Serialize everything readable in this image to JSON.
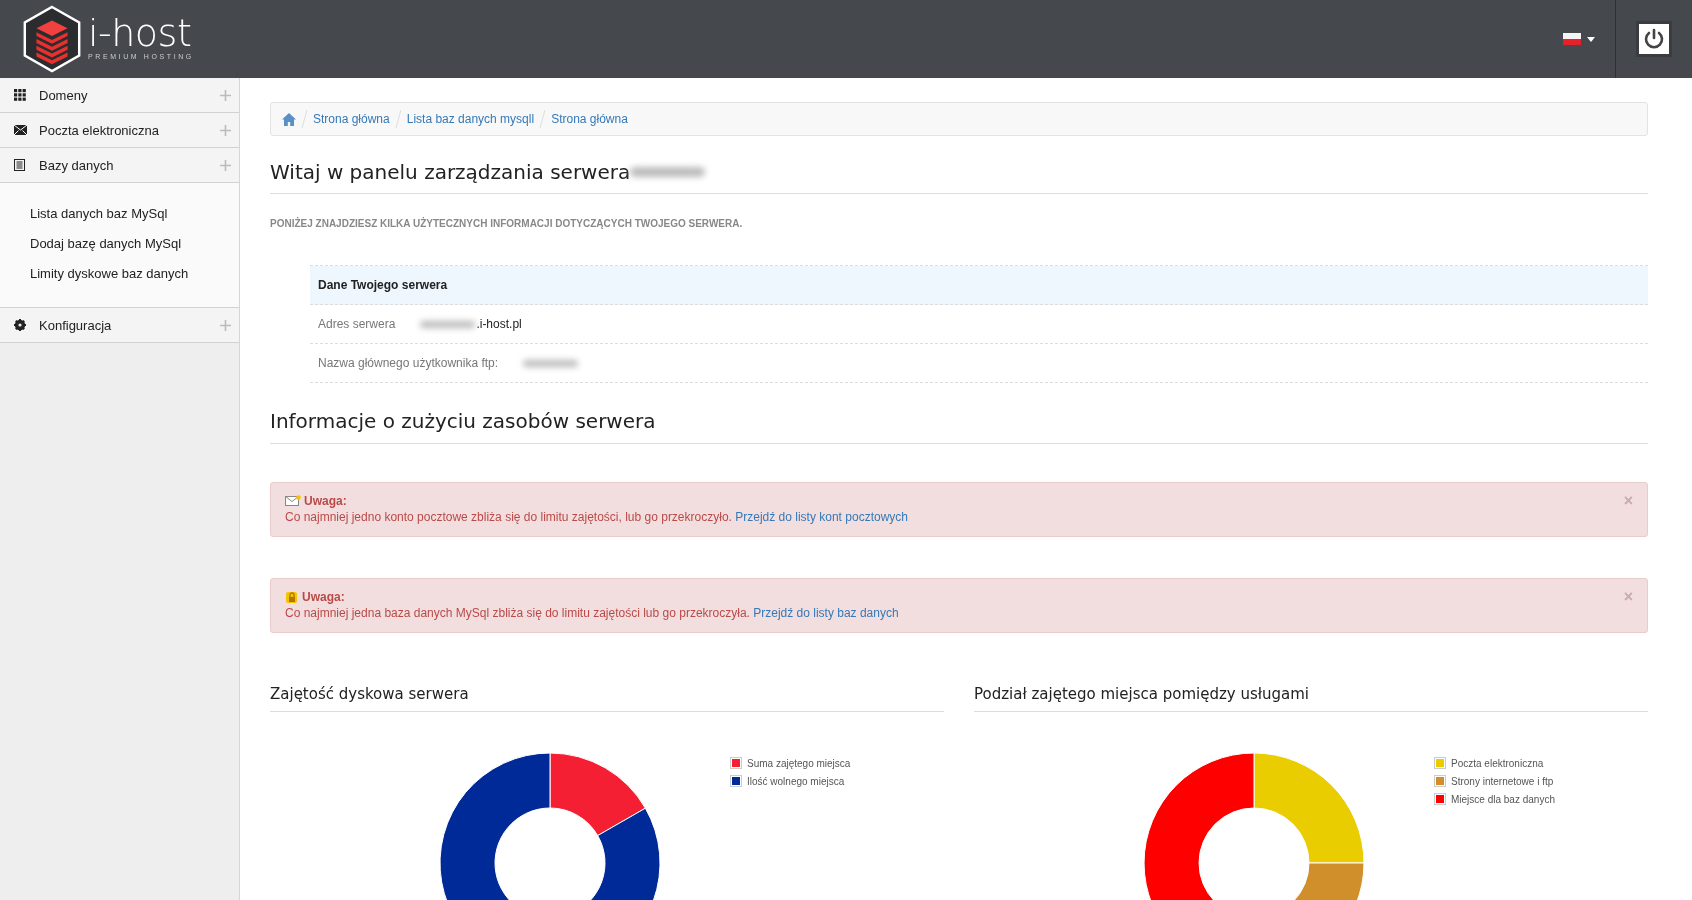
{
  "header": {
    "logo": {
      "name": "i-host",
      "tagline": "PREMIUM HOSTING"
    }
  },
  "sidebar": {
    "items": [
      {
        "label": "Domeny"
      },
      {
        "label": "Poczta elektroniczna"
      },
      {
        "label": "Bazy danych",
        "children": [
          {
            "label": "Lista danych baz MySql"
          },
          {
            "label": "Dodaj bazę danych MySql"
          },
          {
            "label": "Limity dyskowe baz danych"
          }
        ]
      },
      {
        "label": "Konfiguracja"
      }
    ]
  },
  "breadcrumb": [
    "Strona główna",
    "Lista baz danych mysqll",
    "Strona główna"
  ],
  "title": "Witaj w panelu zarządzania serwera",
  "subtitle": "PONIŻEJ ZNAJDZIESZ KILKA UŻYTECZNYCH INFORMACJI DOTYCZĄCYCH TWOJEGO SERWERA.",
  "server_info": {
    "heading": "Dane Twojego serwera",
    "rows": [
      {
        "label": "Adres serwera",
        "value": ".i-host.pl"
      },
      {
        "label": "Nazwa głównego użytkownika ftp:",
        "value": ""
      }
    ]
  },
  "section_title": "Informacje o zużyciu zasobów serwera",
  "alerts": [
    {
      "title": "Uwaga:",
      "text": "Co najmniej jedno konto pocztowe zbliża się do limitu zajętości, lub go przekroczyło.",
      "link": "Przejdź do listy kont pocztowych",
      "close": "×"
    },
    {
      "title": "Uwaga:",
      "text": "Co najmniej jedna baza danych MySql zbliża się do limitu zajętości lub go przekroczyła.",
      "link": "Przejdź do listy baz danych",
      "close": "×"
    }
  ],
  "charts": [
    {
      "title": "Zajętość dyskowa serwera",
      "legend": [
        {
          "label": "Suma zajętego miejsca",
          "color": "#f41f33"
        },
        {
          "label": "Ilość wolnego miejsca",
          "color": "#002a97"
        }
      ]
    },
    {
      "title": "Podział zajętego miejsca pomiędzy usługami",
      "legend": [
        {
          "label": "Poczta elektroniczna",
          "color": "#eacd00"
        },
        {
          "label": "Strony internetowe i ftp",
          "color": "#d18f2c"
        },
        {
          "label": "Miejsce dla baz danych",
          "color": "#ff0000"
        }
      ]
    }
  ]
}
